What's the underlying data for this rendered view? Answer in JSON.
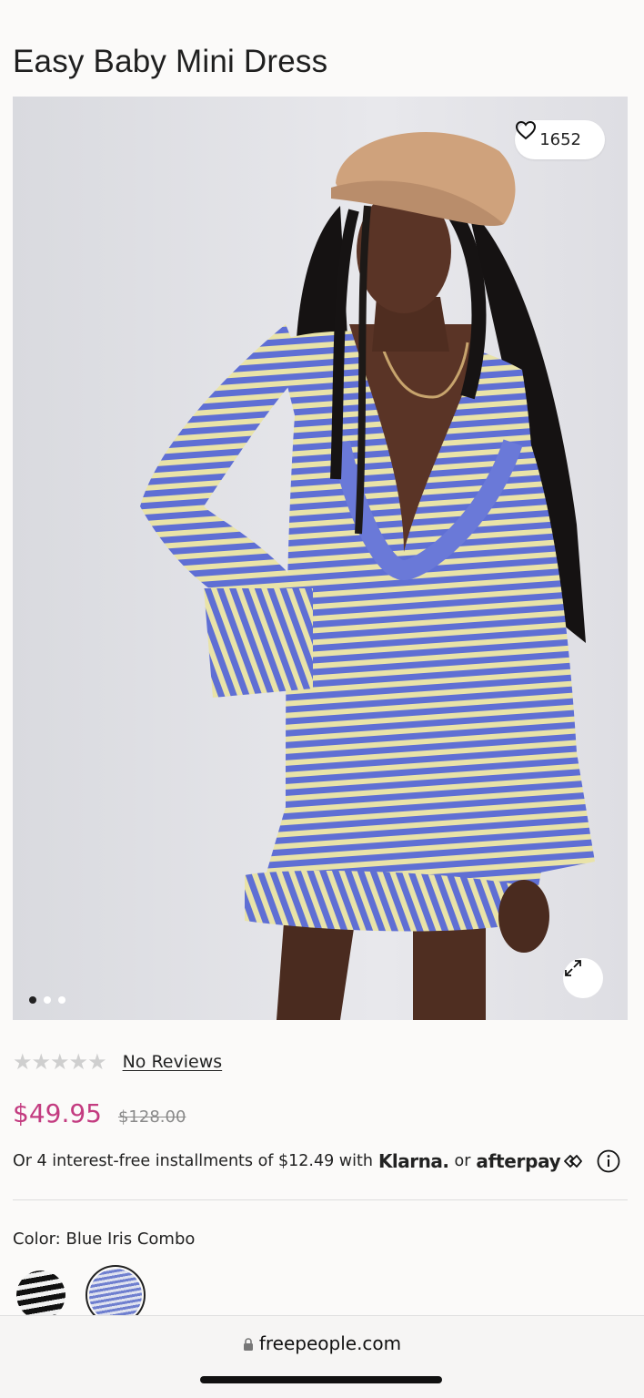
{
  "product": {
    "title": "Easy Baby Mini Dress",
    "likes": "1652",
    "rating_stars": 0,
    "reviews_label": "No Reviews",
    "sale_price": "$49.95",
    "original_price": "$128.00",
    "color_label": "Color: Blue Iris Combo"
  },
  "gallery": {
    "slide_count": 3,
    "active_slide": 1
  },
  "installments": {
    "text": "Or 4 interest-free installments of $12.49 with",
    "klarna": "Klarna.",
    "or": "or",
    "afterpay": "afterpay"
  },
  "swatches": [
    {
      "name": "black-stripe",
      "selected": false
    },
    {
      "name": "blue-iris-combo",
      "selected": true
    }
  ],
  "browser": {
    "url": "freepeople.com"
  },
  "colors": {
    "sale": "#c33b80",
    "dress_blue": "#5f6fd4",
    "dress_cream": "#e9e3a8",
    "background": "#fbfaf9"
  }
}
